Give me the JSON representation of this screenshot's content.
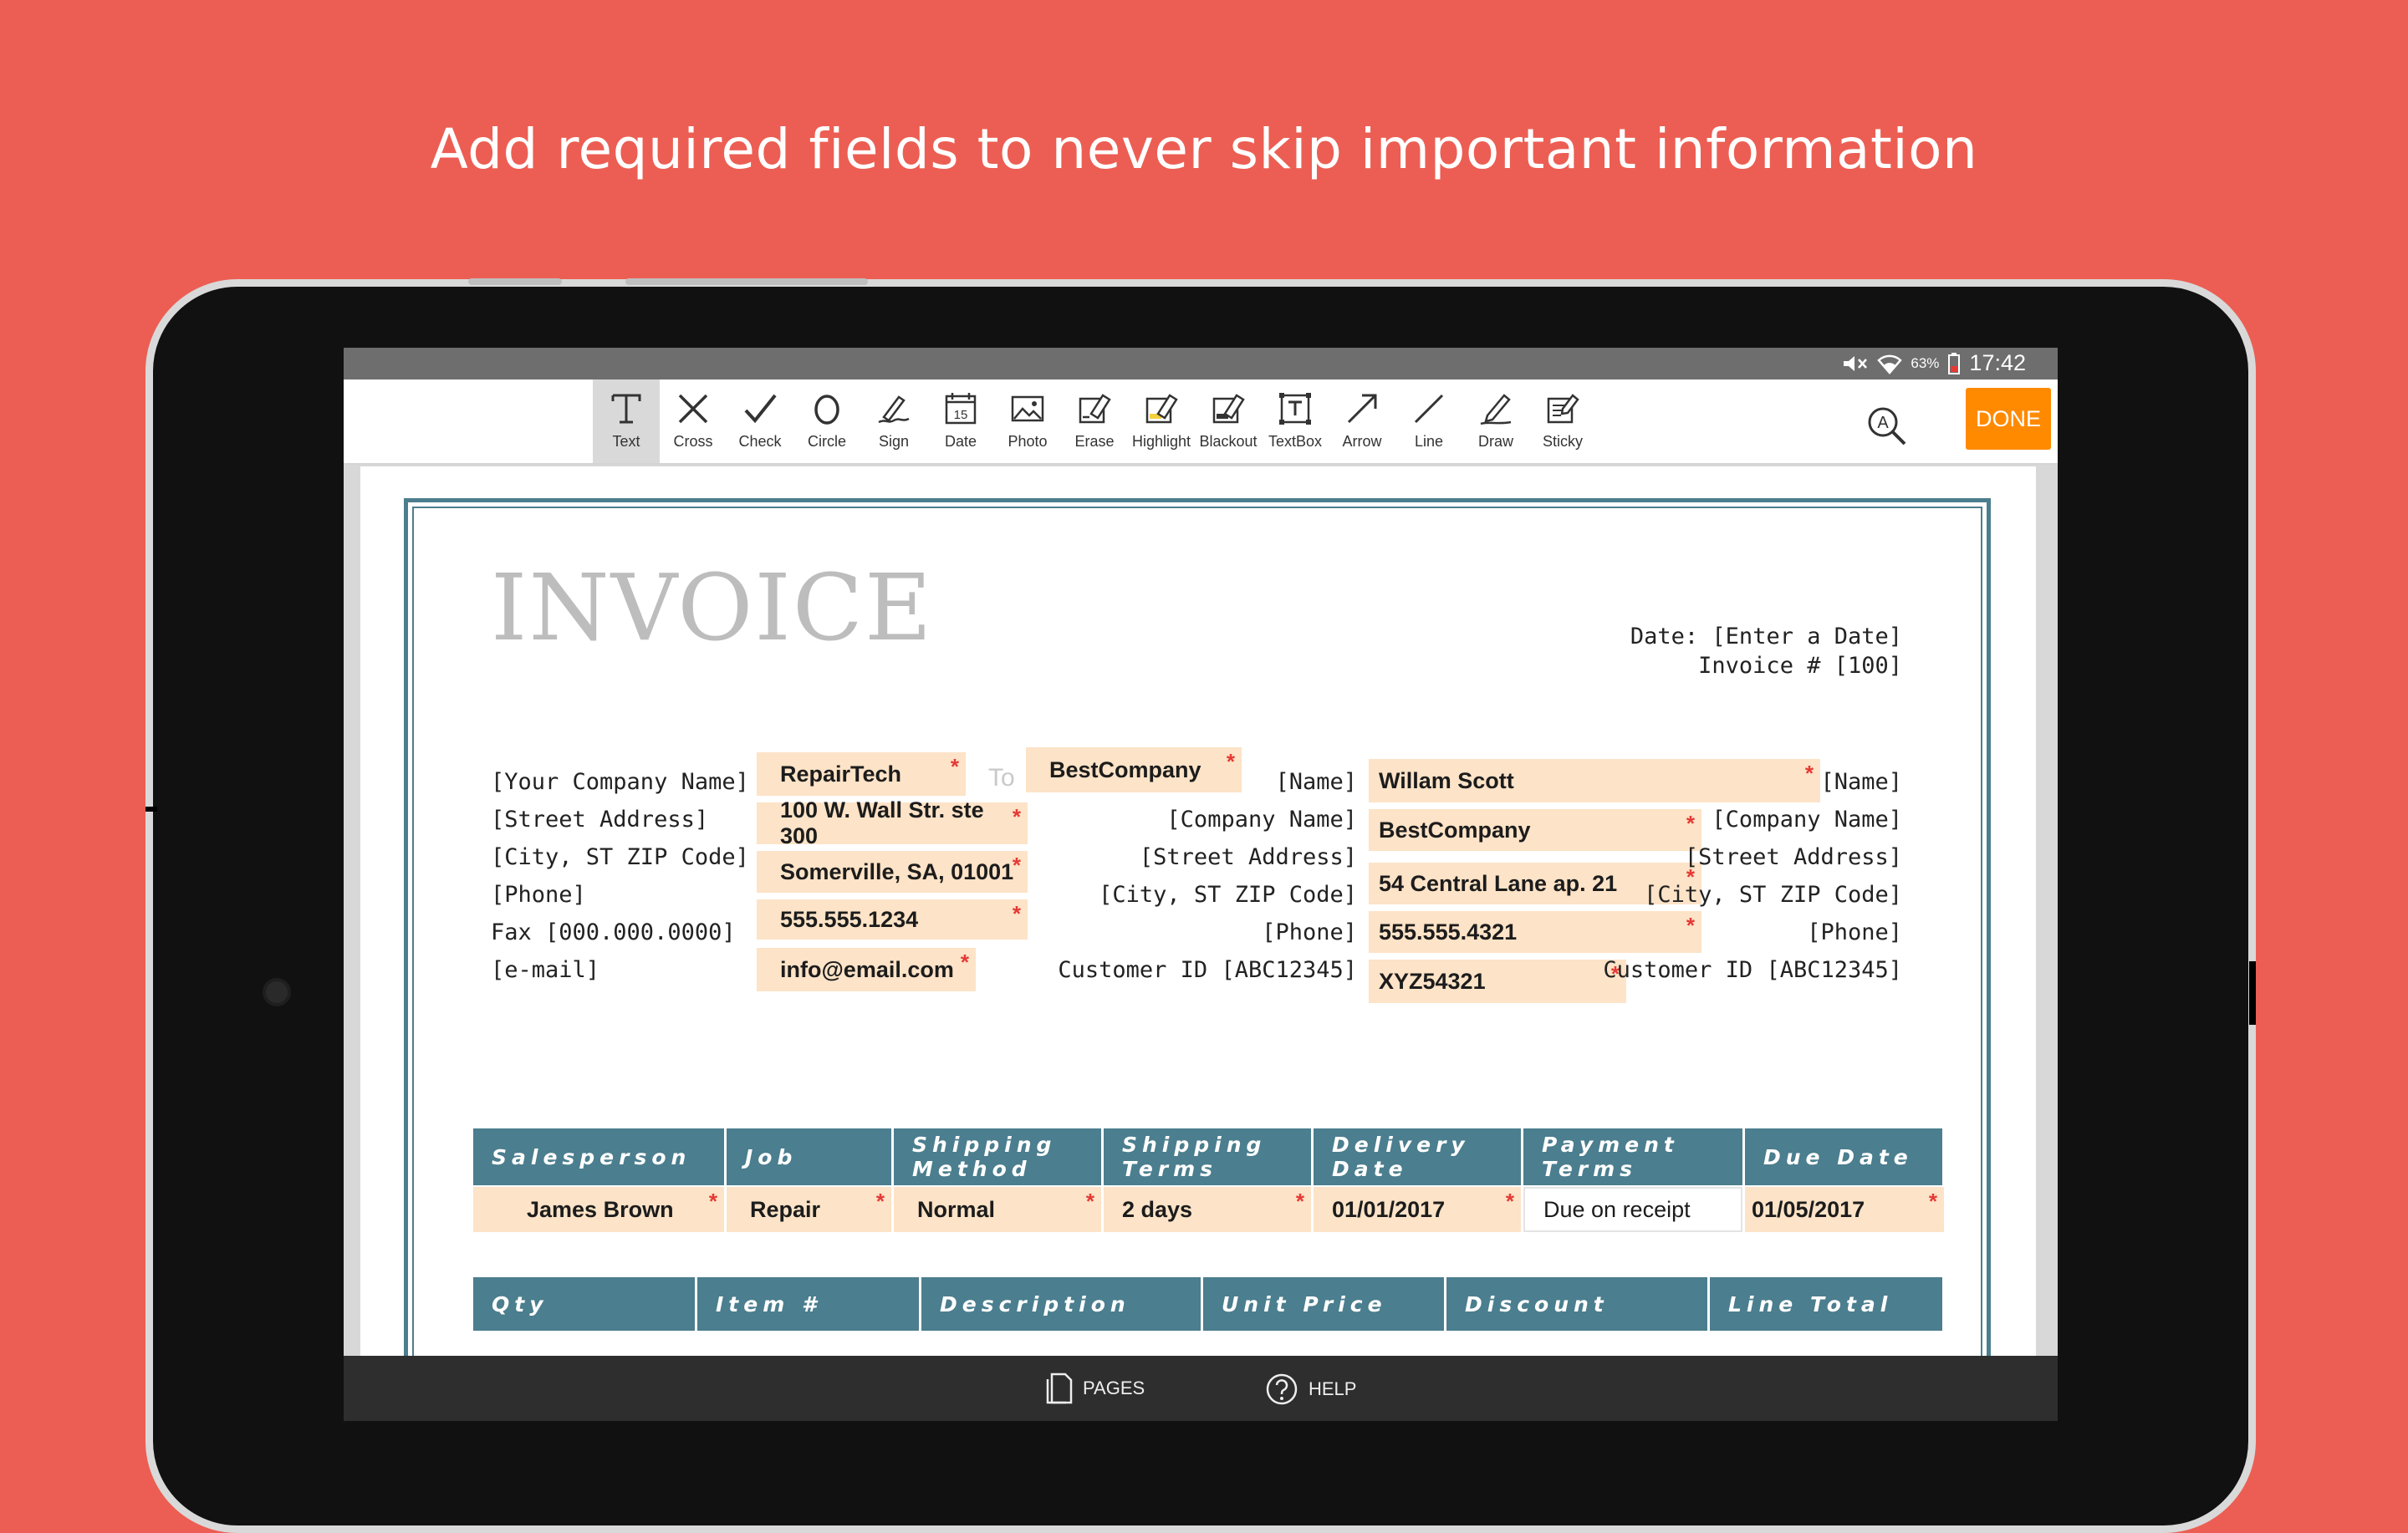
{
  "headline": "Add required fields to never skip important information",
  "status": {
    "battery": "63%",
    "time": "17:42"
  },
  "toolbar": {
    "tools": [
      {
        "label": "Text",
        "icon": "text-icon"
      },
      {
        "label": "Cross",
        "icon": "cross-icon"
      },
      {
        "label": "Check",
        "icon": "check-icon"
      },
      {
        "label": "Circle",
        "icon": "circle-icon"
      },
      {
        "label": "Sign",
        "icon": "sign-icon"
      },
      {
        "label": "Date",
        "icon": "date-icon"
      },
      {
        "label": "Photo",
        "icon": "photo-icon"
      },
      {
        "label": "Erase",
        "icon": "erase-icon"
      },
      {
        "label": "Highlight",
        "icon": "highlight-icon"
      },
      {
        "label": "Blackout",
        "icon": "blackout-icon"
      },
      {
        "label": "TextBox",
        "icon": "textbox-icon"
      },
      {
        "label": "Arrow",
        "icon": "arrow-icon"
      },
      {
        "label": "Line",
        "icon": "line-icon"
      },
      {
        "label": "Draw",
        "icon": "draw-icon"
      },
      {
        "label": "Sticky",
        "icon": "sticky-icon"
      }
    ],
    "date_number": "15",
    "done_label": "DONE"
  },
  "invoice": {
    "title": "INVOICE",
    "date_line": "Date: [Enter a Date]",
    "invoice_line": "Invoice # [100]",
    "from_labels": [
      "[Your Company Name]",
      "[Street Address]",
      "[City, ST  ZIP Code]",
      "[Phone]",
      "Fax [000.000.0000]",
      "[e-mail]"
    ],
    "from_fields": [
      "RepairTech",
      "100 W. Wall Str. ste 300",
      "Somerville, SA, 01001",
      "555.555.1234",
      "info@email.com"
    ],
    "to_label": "To",
    "to_company_field": "BestCompany",
    "mid_labels": [
      "[Name]",
      "[Company Name]",
      "[Street Address]",
      "[City, ST  ZIP Code]",
      "[Phone]",
      "Customer ID [ABC12345]"
    ],
    "right_fields": [
      "Willam Scott",
      "BestCompany",
      "54 Central Lane ap. 21",
      "555.555.4321",
      "XYZ54321"
    ],
    "right_labels": [
      "[Name]",
      "[Company Name]",
      "[Street Address]",
      "[City, ST  ZIP Code]",
      "[Phone]",
      "Customer ID [ABC12345]"
    ],
    "required_mark": "*",
    "table1_headers": [
      "Salesperson",
      "Job",
      "Shipping Method",
      "Shipping Terms",
      "Delivery Date",
      "Payment Terms",
      "Due Date"
    ],
    "table1_values": [
      "James Brown",
      "Repair",
      "Normal",
      "2 days",
      "01/01/2017",
      "Due on receipt",
      "01/05/2017"
    ],
    "table2_headers": [
      "Qty",
      "Item #",
      "Description",
      "Unit Price",
      "Discount",
      "Line Total"
    ]
  },
  "bottom": {
    "pages_label": "PAGES",
    "help_label": "HELP"
  }
}
